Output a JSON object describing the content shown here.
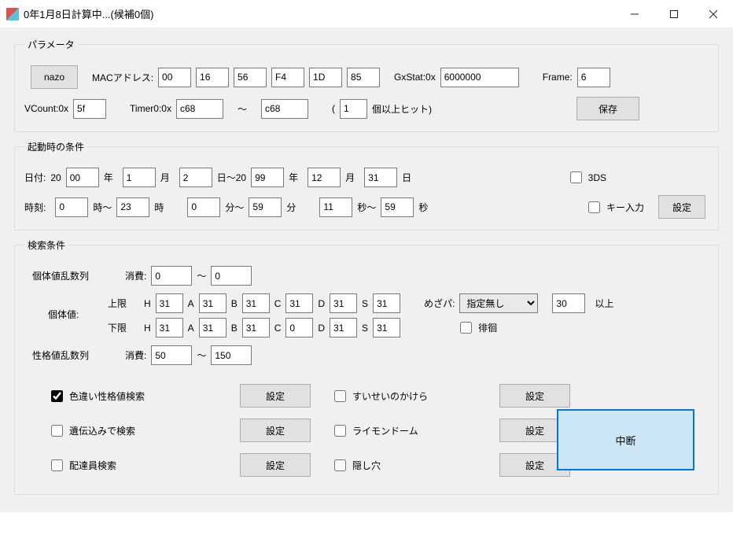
{
  "window": {
    "title": "0年1月8日計算中...(候補0個)"
  },
  "groups": {
    "params": "パラメータ",
    "startup": "起動時の条件",
    "search": "検索条件"
  },
  "params": {
    "nazo_btn": "nazo",
    "mac_label": "MACアドレス:",
    "mac": [
      "00",
      "16",
      "56",
      "F4",
      "1D",
      "85"
    ],
    "gxstat_label": "GxStat:0x",
    "gxstat": "6000000",
    "frame_label": "Frame:",
    "frame": "6",
    "vcount_label": "VCount:0x",
    "vcount": "5f",
    "timer0_label": "Timer0:0x",
    "timer0_from": "c68",
    "timer0_sep": "～",
    "timer0_to": "c68",
    "hit_open": "(",
    "hit_count": "1",
    "hit_close_label": "個以上ヒット)",
    "save_btn": "保存"
  },
  "startup": {
    "date_label": "日付:",
    "y_prefix": "20",
    "y_from": "00",
    "y_lbl": "年",
    "m_from": "1",
    "m_lbl": "月",
    "d_from": "2",
    "d_lbl": "日",
    "range_sep": "～20",
    "y_to": "99",
    "m_to": "12",
    "d_to": "31",
    "d_to_lbl": "日",
    "cb_3ds": "3DS",
    "time_label": "時刻:",
    "h_from": "0",
    "h_sep": "時～",
    "h_to": "23",
    "h_lbl": "時",
    "min_from": "0",
    "min_sep": "分～",
    "min_to": "59",
    "min_lbl": "分",
    "s_from": "11",
    "s_sep": "秒～",
    "s_to": "59",
    "s_lbl": "秒",
    "cb_key": "キー入力",
    "set_btn": "設定"
  },
  "search": {
    "iv_seq_label": "個体値乱数列",
    "consume_label": "消費:",
    "iv_consume_from": "0",
    "sep": "～",
    "iv_consume_to": "0",
    "iv_label": "個体値:",
    "upper_label": "上限",
    "lower_label": "下限",
    "stat_lbl": {
      "H": "H",
      "A": "A",
      "B": "B",
      "C": "C",
      "D": "D",
      "S": "S"
    },
    "upper": {
      "H": "31",
      "A": "31",
      "B": "31",
      "C": "31",
      "D": "31",
      "S": "31"
    },
    "lower": {
      "H": "31",
      "A": "31",
      "B": "31",
      "C": "0",
      "D": "31",
      "S": "31"
    },
    "hp_label": "めざパ:",
    "hp_type": "指定無し",
    "hp_power": "30",
    "hp_ge_label": "以上",
    "cb_roam": "徘徊",
    "nature_seq_label": "性格値乱数列",
    "nature_consume_from": "50",
    "nature_consume_to": "150",
    "opts": {
      "shiny": {
        "label": "色違い性格値検索",
        "checked": true,
        "btn": "設定"
      },
      "inherit": {
        "label": "遺伝込みで検索",
        "checked": false,
        "btn": "設定"
      },
      "delivery": {
        "label": "配達員検索",
        "checked": false,
        "btn": "設定"
      },
      "suisei": {
        "label": "すいせいのかけら",
        "checked": false,
        "btn": "設定"
      },
      "raimon": {
        "label": "ライモンドーム",
        "checked": false,
        "btn": "設定"
      },
      "hole": {
        "label": "隠し穴",
        "checked": false,
        "btn": "設定"
      }
    },
    "abort_btn": "中断"
  }
}
